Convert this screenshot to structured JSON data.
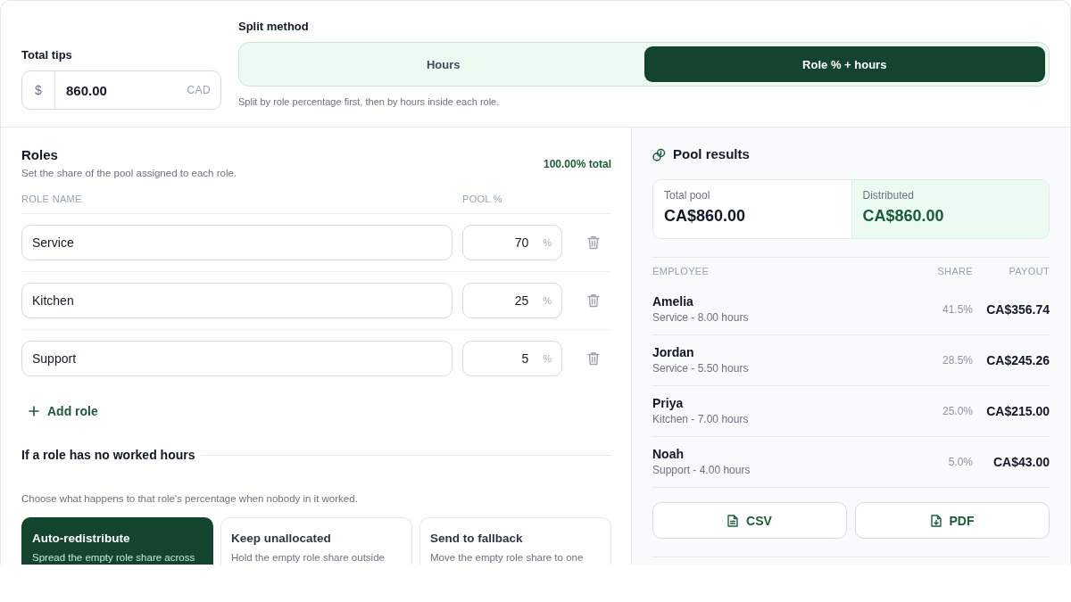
{
  "total_tips": {
    "label": "Total tips",
    "prefix": "$",
    "value": "860.00",
    "suffix": "CAD"
  },
  "split_method": {
    "label": "Split method",
    "options": [
      {
        "label": "Hours",
        "selected": false
      },
      {
        "label": "Role % + hours",
        "selected": true
      }
    ],
    "help": "Split by role percentage first, then by hours inside each role."
  },
  "roles": {
    "title": "Roles",
    "subtitle": "Set the share of the pool assigned to each role.",
    "total": "100.00% total",
    "columns": [
      "ROLE NAME",
      "POOL %"
    ],
    "rows": [
      {
        "name": "Service",
        "percent": "70",
        "unit": "%"
      },
      {
        "name": "Kitchen",
        "percent": "25",
        "unit": "%"
      },
      {
        "name": "Support",
        "percent": "5",
        "unit": "%"
      }
    ],
    "add_button": "Add role"
  },
  "empty_role": {
    "title": "If a role has no worked hours",
    "help": "Choose what happens to that role's percentage when nobody in it worked.",
    "options": [
      {
        "title": "Auto-redistribute",
        "description": "Spread the empty role share across",
        "selected": true
      },
      {
        "title": "Keep unallocated",
        "description": "Hold the empty role share outside",
        "selected": false
      },
      {
        "title": "Send to fallback",
        "description": "Move the empty role share to one",
        "selected": false
      }
    ]
  },
  "pool_results": {
    "title": "Pool results",
    "summary": [
      {
        "label": "Total pool",
        "value": "CA$860.00",
        "highlighted": false
      },
      {
        "label": "Distributed",
        "value": "CA$860.00",
        "highlighted": true
      }
    ],
    "columns": [
      "EMPLOYEE",
      "SHARE",
      "PAYOUT"
    ],
    "rows": [
      {
        "name": "Amelia",
        "detail": "Service - 8.00 hours",
        "share": "41.5%",
        "payout": "CA$356.74"
      },
      {
        "name": "Jordan",
        "detail": "Service - 5.50 hours",
        "share": "28.5%",
        "payout": "CA$245.26"
      },
      {
        "name": "Priya",
        "detail": "Kitchen - 7.00 hours",
        "share": "25.0%",
        "payout": "CA$215.00"
      },
      {
        "name": "Noah",
        "detail": "Support - 4.00 hours",
        "share": "5.0%",
        "payout": "CA$43.00"
      }
    ],
    "exports": [
      "CSV",
      "PDF"
    ]
  }
}
